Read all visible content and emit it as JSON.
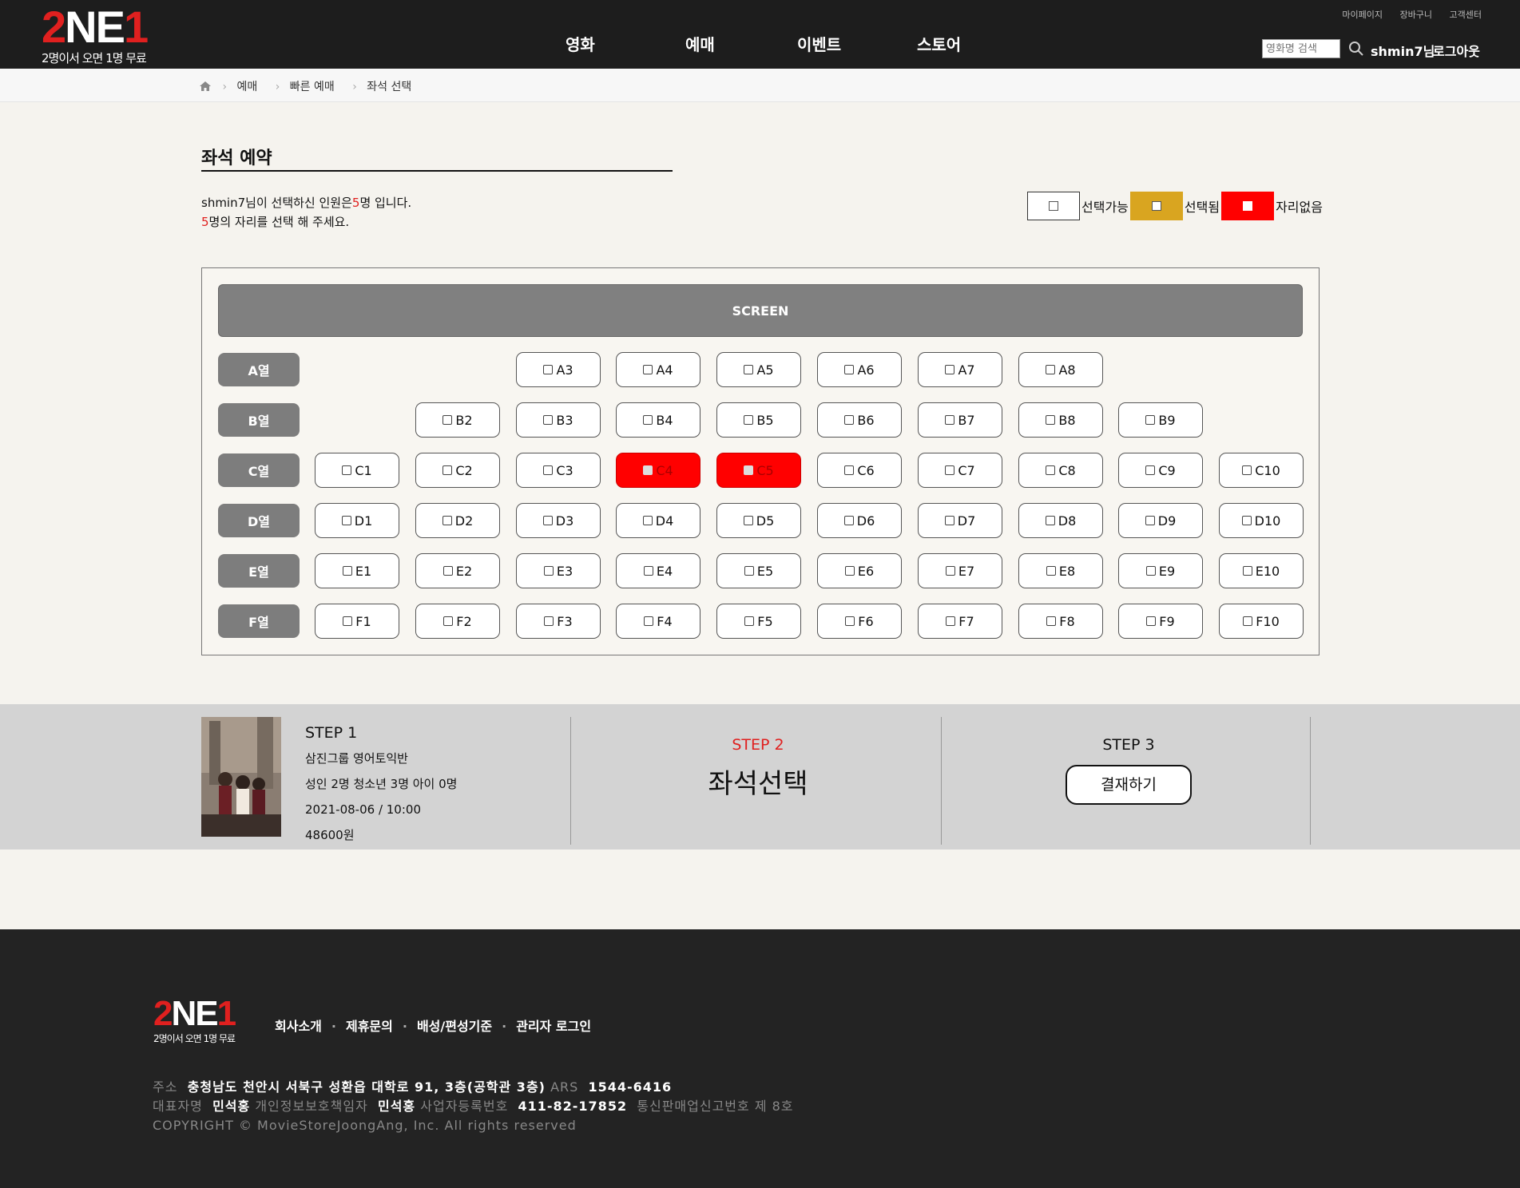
{
  "header": {
    "logo_mark_a": "2",
    "logo_mark_b": "NE",
    "logo_mark_c": "1",
    "logo_sub": "2명이서 오면 1명 무료",
    "nav": [
      "영화",
      "예매",
      "이벤트",
      "스토어"
    ],
    "util": [
      "마이페이지",
      "장바구니",
      "고객센터"
    ],
    "search_placeholder": "영화명 검색",
    "user": "shmin7님",
    "logout": "로그아웃"
  },
  "breadcrumb": [
    "예매",
    "빠른 예매",
    "좌석 선택"
  ],
  "main": {
    "title": "좌석 예약",
    "msg_line1_a": "shmin7님이 선택하신 인원은",
    "msg_count": "5",
    "msg_line1_b": "명 입니다.",
    "msg_line2_count": "5",
    "msg_line2_b": "명의 자리를 선택 해 주세요."
  },
  "legend": {
    "available": "선택가능",
    "selected": "선택됨",
    "unavailable": "자리없음",
    "available_color": "#ffffff",
    "selected_color": "#d9a520",
    "unavailable_color": "#ff0000"
  },
  "seatmap": {
    "screen_label": "SCREEN",
    "rows": [
      {
        "label": "A열",
        "seats": [
          "A3",
          "A4",
          "A5",
          "A6",
          "A7",
          "A8"
        ],
        "start": 3
      },
      {
        "label": "B열",
        "seats": [
          "B2",
          "B3",
          "B4",
          "B5",
          "B6",
          "B7",
          "B8",
          "B9"
        ],
        "start": 2
      },
      {
        "label": "C열",
        "seats": [
          "C1",
          "C2",
          "C3",
          "C4",
          "C5",
          "C6",
          "C7",
          "C8",
          "C9",
          "C10"
        ],
        "start": 1,
        "taken": [
          "C4",
          "C5"
        ]
      },
      {
        "label": "D열",
        "seats": [
          "D1",
          "D2",
          "D3",
          "D4",
          "D5",
          "D6",
          "D7",
          "D8",
          "D9",
          "D10"
        ],
        "start": 1
      },
      {
        "label": "E열",
        "seats": [
          "E1",
          "E2",
          "E3",
          "E4",
          "E5",
          "E6",
          "E7",
          "E8",
          "E9",
          "E10"
        ],
        "start": 1
      },
      {
        "label": "F열",
        "seats": [
          "F1",
          "F2",
          "F3",
          "F4",
          "F5",
          "F6",
          "F7",
          "F8",
          "F9",
          "F10"
        ],
        "start": 1
      }
    ]
  },
  "steps": {
    "step1": {
      "heading": "STEP 1",
      "movie": "삼진그룹 영어토익반",
      "people": "성인 2명 청소년 3명 아이 0명",
      "datetime": "2021-08-06  / 10:00",
      "price": "48600원",
      "poster_text": "삼진그룹 영어토익반"
    },
    "step2": {
      "heading": "STEP 2",
      "title": "좌석선택"
    },
    "step3": {
      "heading": "STEP 3",
      "button": "결재하기"
    }
  },
  "footer": {
    "logo_sub": "2명이서 오면 1명 무료",
    "links": [
      "회사소개",
      "제휴문의",
      "배성/편성기준",
      "관리자 로그인"
    ],
    "addr_label": "주소",
    "addr": "충청남도 천안시 서북구 성환읍 대학로 91, 3층(공학관 3층)",
    "ars_label": "ARS",
    "ars": "1544-6416",
    "ceo_label": "대표자명",
    "ceo": "민석홍",
    "privacy_label": "개인정보보호책임자",
    "privacy": "민석홍",
    "biz_label": "사업자등록번호",
    "biz": "411-82-17852",
    "mail_label": "통신판매업신고번호 제 8호",
    "copyright": "COPYRIGHT © MovieStoreJoongAng, Inc. All rights reserved"
  }
}
